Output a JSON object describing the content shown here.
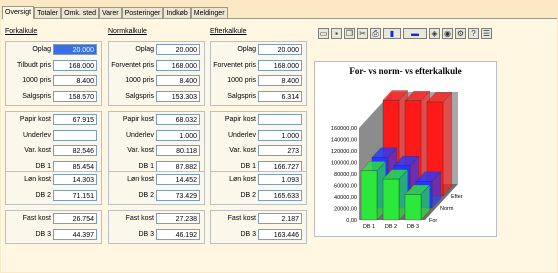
{
  "tabs": [
    {
      "label": "Oversigt",
      "active": true
    },
    {
      "label": "Totaler"
    },
    {
      "label": "Omk. sted"
    },
    {
      "label": "Varer"
    },
    {
      "label": "Posteringer"
    },
    {
      "label": "Indkøb"
    },
    {
      "label": "Meldinger"
    }
  ],
  "columns": [
    {
      "header": "Forkalkule",
      "groups": [
        [
          {
            "label": "Oplag",
            "value": "20.000",
            "selected": true
          },
          {
            "label": "Tilbudt pris",
            "value": "168.000"
          },
          {
            "label": "1000 pris",
            "value": "8.400"
          },
          {
            "label": "Salgspris",
            "value": "158.570"
          }
        ],
        [
          {
            "label": "Papir kost",
            "value": "67.915"
          },
          {
            "label": "Underlev",
            "value": ""
          },
          {
            "label": "Var. kost",
            "value": "82.546"
          },
          {
            "label": "DB 1",
            "value": "85.454"
          }
        ],
        [
          {
            "label": "Løn kost",
            "value": "14.303"
          },
          {
            "label": "DB 2",
            "value": "71.151"
          }
        ],
        [
          {
            "label": "Fast kost",
            "value": "26.754"
          },
          {
            "label": "DB 3",
            "value": "44.397"
          }
        ]
      ]
    },
    {
      "header": "Normkalkule",
      "groups": [
        [
          {
            "label": "Oplag",
            "value": "20.000"
          },
          {
            "label": "Forventet pris",
            "value": "168.000"
          },
          {
            "label": "1000 pris",
            "value": "8.400"
          },
          {
            "label": "Salgspris",
            "value": "153.303"
          }
        ],
        [
          {
            "label": "Papir kost",
            "value": "68.032"
          },
          {
            "label": "Underlev",
            "value": "1.000"
          },
          {
            "label": "Var. kost",
            "value": "80.118"
          },
          {
            "label": "DB 1",
            "value": "87.882"
          }
        ],
        [
          {
            "label": "Løn kost",
            "value": "14.452"
          },
          {
            "label": "DB 2",
            "value": "73.429"
          }
        ],
        [
          {
            "label": "Fast kost",
            "value": "27.238"
          },
          {
            "label": "DB 3",
            "value": "46.192"
          }
        ]
      ]
    },
    {
      "header": "Efterkalkule",
      "groups": [
        [
          {
            "label": "Oplag",
            "value": "20.000"
          },
          {
            "label": "Forventet pris",
            "value": "168.000"
          },
          {
            "label": "1000 pris",
            "value": "8.400"
          },
          {
            "label": "Salgspris",
            "value": "6.314"
          }
        ],
        [
          {
            "label": "Papir kost",
            "value": ""
          },
          {
            "label": "Underlev",
            "value": "1.000"
          },
          {
            "label": "Var. kost",
            "value": "273"
          },
          {
            "label": "DB 1",
            "value": "166.727"
          }
        ],
        [
          {
            "label": "Løn kost",
            "value": "1.093"
          },
          {
            "label": "DB 2",
            "value": "165.633"
          }
        ],
        [
          {
            "label": "Fast kost",
            "value": "2.187"
          },
          {
            "label": "DB 3",
            "value": "163.446"
          }
        ]
      ]
    }
  ],
  "toolbar": [
    {
      "icon": "folder-open-icon",
      "glyph": "▭"
    },
    {
      "icon": "save-icon",
      "glyph": "▪"
    },
    {
      "icon": "copy-icon",
      "glyph": "❐"
    },
    {
      "icon": "cut-icon",
      "glyph": "✂"
    },
    {
      "icon": "print-icon",
      "glyph": "⎙"
    },
    {
      "icon": "chart-type-icon",
      "glyph": "▮"
    },
    {
      "icon": "color-select-icon",
      "glyph": "▬"
    },
    {
      "icon": "3d-view-icon",
      "glyph": "◈"
    },
    {
      "icon": "rotate-icon",
      "glyph": "◉"
    },
    {
      "icon": "options-icon",
      "glyph": "⚙"
    },
    {
      "icon": "help-icon",
      "glyph": "?"
    },
    {
      "icon": "document-icon",
      "glyph": "☰"
    }
  ],
  "colors": {
    "forkalkule": "#ff1a1a",
    "normkalkule": "#2438ff",
    "efterkalkule": "#2ce83a"
  },
  "chart_data": {
    "type": "bar",
    "title": "For- vs norm- vs efterkalkule",
    "categories": [
      "DB 1",
      "DB 2",
      "DB 3"
    ],
    "depth_labels": [
      "For",
      "Norm",
      "Efter"
    ],
    "series": [
      {
        "name": "For",
        "values": [
          85454,
          71151,
          44397
        ],
        "color": "#2ce83a"
      },
      {
        "name": "Norm",
        "values": [
          87882,
          73429,
          46192
        ],
        "color": "#2438ff"
      },
      {
        "name": "Efter",
        "values": [
          166727,
          165633,
          163446
        ],
        "color": "#ff1a1a"
      }
    ],
    "ytick_labels": [
      "0,00",
      "20000,00",
      "40000,00",
      "60000,00",
      "80000,00",
      "100000,00",
      "120000,00",
      "140000,00",
      "160000,00"
    ],
    "ylim": [
      0,
      160000
    ],
    "grid": false,
    "legend": "none"
  }
}
